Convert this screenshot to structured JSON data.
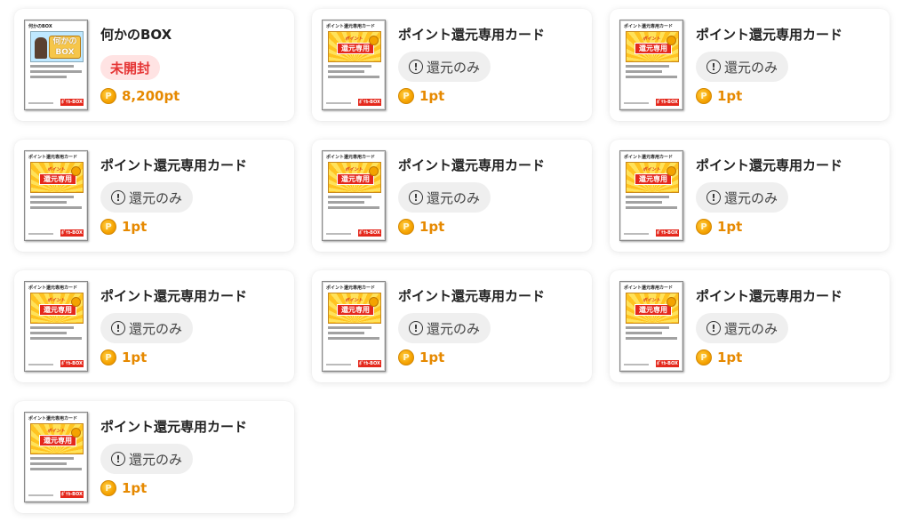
{
  "box_card": {
    "thumb_title": "何かのBOX",
    "thumb_box_word": "何かのBOX",
    "title": "何かのBOX",
    "status": "未開封",
    "points": "8,200pt"
  },
  "point_card_template": {
    "thumb_title": "ポイント還元専用カード",
    "thumb_banner_top": "ポイント",
    "thumb_banner": "還元専用",
    "thumb_logo": "ﾎﾟｹｶ-BOX",
    "title": "ポイント還元専用カード",
    "status": "還元のみ",
    "points": "1pt"
  },
  "point_cards": [
    {
      "title": "ポイント還元専用カード",
      "status": "還元のみ",
      "points": "1pt"
    },
    {
      "title": "ポイント還元専用カード",
      "status": "還元のみ",
      "points": "1pt"
    },
    {
      "title": "ポイント還元専用カード",
      "status": "還元のみ",
      "points": "1pt"
    },
    {
      "title": "ポイント還元専用カード",
      "status": "還元のみ",
      "points": "1pt"
    },
    {
      "title": "ポイント還元専用カード",
      "status": "還元のみ",
      "points": "1pt"
    },
    {
      "title": "ポイント還元専用カード",
      "status": "還元のみ",
      "points": "1pt"
    },
    {
      "title": "ポイント還元専用カード",
      "status": "還元のみ",
      "points": "1pt"
    },
    {
      "title": "ポイント還元専用カード",
      "status": "還元のみ",
      "points": "1pt"
    },
    {
      "title": "ポイント還元専用カード",
      "status": "還元のみ",
      "points": "1pt"
    }
  ],
  "icons": {
    "info": "info-circle-icon",
    "coin": "coin-icon"
  },
  "colors": {
    "points": "#e68900",
    "unopened_text": "#e53535",
    "unopened_bg": "#ffe3e3",
    "refund_bg": "#efefef"
  }
}
